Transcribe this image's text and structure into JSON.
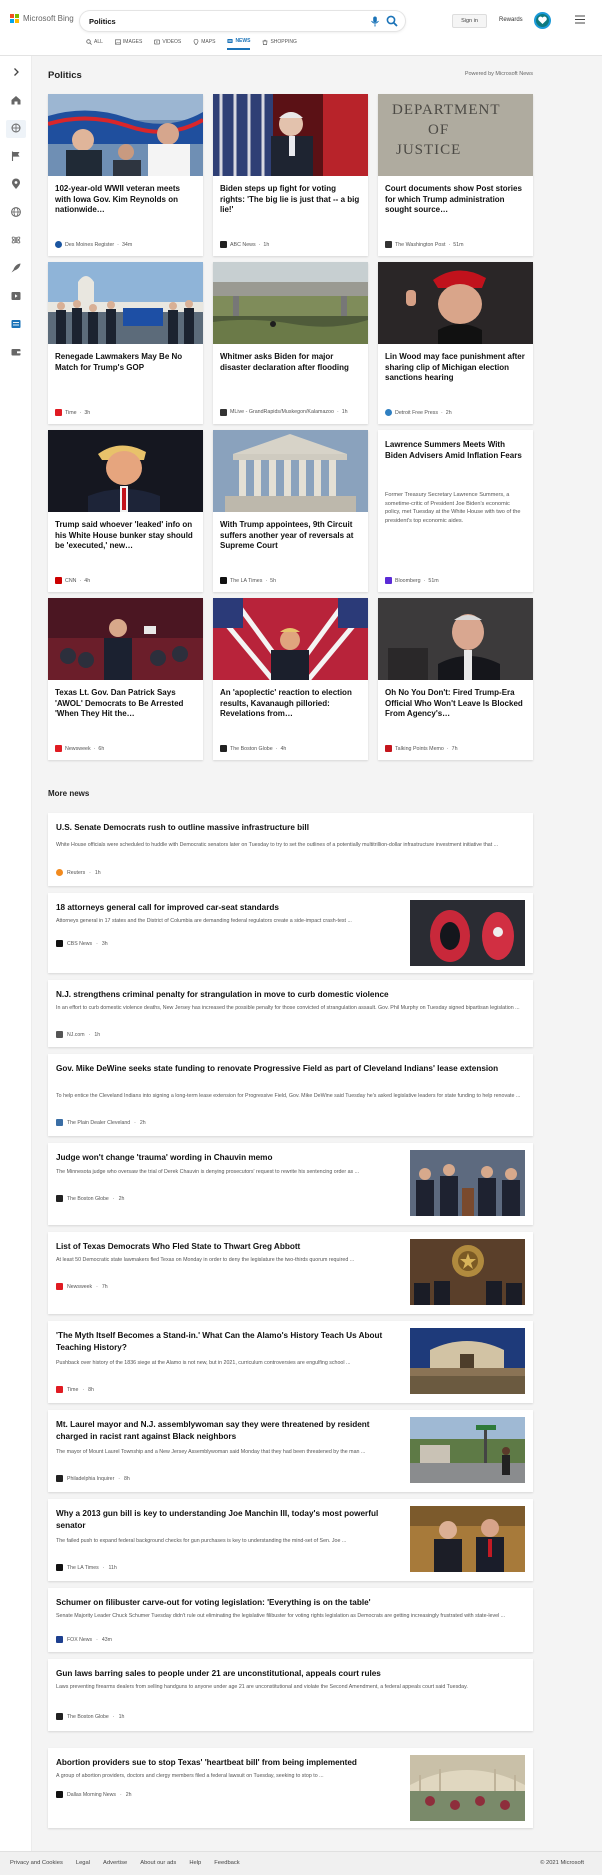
{
  "header": {
    "brand": "Microsoft Bing",
    "search_value": "Politics",
    "signin_label": "Sign in",
    "rewards_label": "Rewards"
  },
  "tabs": [
    {
      "label": "ALL",
      "icon": "search-icon"
    },
    {
      "label": "IMAGES",
      "icon": "image-icon"
    },
    {
      "label": "VIDEOS",
      "icon": "video-icon"
    },
    {
      "label": "MAPS",
      "icon": "map-pin-icon"
    },
    {
      "label": "NEWS",
      "icon": "news-icon"
    },
    {
      "label": "SHOPPING",
      "icon": "shopping-bag-icon"
    }
  ],
  "sidebar": [
    "collapse-icon",
    "home-icon",
    "sports-icon",
    "flag-icon",
    "location-icon",
    "globe-icon",
    "science-icon",
    "rocket-icon",
    "entertainment-icon",
    "news-icon",
    "wallet-icon"
  ],
  "section": {
    "title": "Politics",
    "powered_by": "Powered by Microsoft News"
  },
  "cards": [
    {
      "title": "102-year-old WWII veteran meets with Iowa Gov. Kim Reynolds on nationwide…",
      "source": "Des Moines Register",
      "time": "34m",
      "color": "#1b55a0"
    },
    {
      "title": "Biden steps up fight for voting rights: 'The big lie is just that -- a big lie!'",
      "source": "ABC News",
      "time": "1h",
      "color": "#222222"
    },
    {
      "title": "Court documents show Post stories for which Trump administration sought source…",
      "source": "The Washington Post",
      "time": "51m",
      "color": "#333333"
    },
    {
      "title": "Renegade Lawmakers May Be No Match for Trump's GOP",
      "source": "Time",
      "time": "3h",
      "color": "#e01b22"
    },
    {
      "title": "Whitmer asks Biden for major disaster declaration after flooding",
      "source": "MLive - GrandRapids/Muskegon/Kalamazoo",
      "time": "1h",
      "color": "#333333"
    },
    {
      "title": "Lin Wood may face punishment after sharing clip of Michigan election sanctions hearing",
      "source": "Detroit Free Press",
      "time": "2h",
      "color": "#2f7fc1"
    },
    {
      "title": "Trump said whoever 'leaked' info on his White House bunker stay should be 'executed,' new…",
      "source": "CNN",
      "time": "4h",
      "color": "#cc0000"
    },
    {
      "title": "With Trump appointees, 9th Circuit suffers another year of reversals at Supreme Court",
      "source": "The LA Times",
      "time": "5h",
      "color": "#111111"
    },
    {
      "title": "Lawrence Summers Meets With Biden Advisers Amid Inflation Fears",
      "snippet": "Former Treasury Secretary Lawrence Summers, a sometime-critic of President Joe Biden's economic policy, met Tuesday at the White House with two of the president's top economic aides.",
      "source": "Bloomberg",
      "time": "51m",
      "color": "#5b2bd6"
    },
    {
      "title": "Texas Lt. Gov. Dan Patrick Says 'AWOL' Democrats to Be Arrested 'When They Hit the…",
      "source": "Newsweek",
      "time": "6h",
      "color": "#e01b22"
    },
    {
      "title": "An 'apoplectic' reaction to election results, Kavanaugh pilloried: Revelations from…",
      "source": "The Boston Globe",
      "time": "4h",
      "color": "#222222"
    },
    {
      "title": "Oh No You Don't: Fired Trump-Era Official Who Won't Leave Is Blocked From Agency's…",
      "source": "Talking Points Memo",
      "time": "7h",
      "color": "#c4151c"
    }
  ],
  "more_news": {
    "title": "More news",
    "items": [
      {
        "title": "U.S. Senate Democrats rush to outline massive infrastructure bill",
        "snippet": "White House officials were scheduled to huddle with Democratic senators later on Tuesday to try to set the outlines of a potentially multitrillion-dollar infrastructure investment initiative that ...",
        "source": "Reuters",
        "time": "1h",
        "color": "#f28a1e"
      },
      {
        "title": "18 attorneys general call for improved car-seat standards",
        "snippet": "Attorneys general in 17 states and the District of Columbia are demanding federal regulators create a side-impact crash-test ...",
        "source": "CBS News",
        "time": "3h",
        "color": "#111111"
      },
      {
        "title": "N.J. strengthens criminal penalty for strangulation in move to curb domestic violence",
        "snippet": "In an effort to curb domestic violence deaths, New Jersey has increased the possible penalty for those convicted of strangulation assault. Gov. Phil Murphy on Tuesday signed bipartisan legislation ...",
        "source": "NJ.com",
        "time": "1h",
        "color": "#555555"
      },
      {
        "title": "Gov. Mike DeWine seeks state funding to renovate Progressive Field as part of Cleveland Indians' lease extension",
        "snippet": "To help entice the Cleveland Indians into signing a long-term lease extension for Progressive Field, Gov. Mike DeWine said Tuesday he's asked legislative leaders for state funding to help renovate ...",
        "source": "The Plain Dealer Cleveland",
        "time": "2h",
        "color": "#3a6ea5"
      },
      {
        "title": "Judge won't change 'trauma' wording in Chauvin memo",
        "snippet": "The Minnesota judge who oversaw the trial of Derek Chauvin is denying prosecutors' request to rewrite his sentencing order as ...",
        "source": "The Boston Globe",
        "time": "2h",
        "color": "#222222"
      },
      {
        "title": "List of Texas Democrats Who Fled State to Thwart Greg Abbott",
        "snippet": "At least 50 Democratic state lawmakers fled Texas on Monday in order to deny the legislature the two-thirds quorum required ...",
        "source": "Newsweek",
        "time": "7h",
        "color": "#e01b22"
      },
      {
        "title": "'The Myth Itself Becomes a Stand-in.' What Can the Alamo's History Teach Us About Teaching History?",
        "snippet": "Pushback over history of the 1836 siege at the Alamo is not new, but in 2021, curriculum controversies are engulfing school ...",
        "source": "Time",
        "time": "8h",
        "color": "#e01b22"
      },
      {
        "title": "Mt. Laurel mayor and N.J. assemblywoman say they were threatened by resident charged in racist rant against Black neighbors",
        "snippet": "The mayor of Mount Laurel Township and a New Jersey Assemblywoman said Monday that they had been threatened by the man ...",
        "source": "Philadelphia Inquirer",
        "time": "8h",
        "color": "#222222"
      },
      {
        "title": "Why a 2013 gun bill is key to understanding Joe Manchin III, today's most powerful senator",
        "snippet": "The failed push to expand federal background checks for gun purchases is key to understanding the mind-set of Sen. Joe ...",
        "source": "The LA Times",
        "time": "11h",
        "color": "#111111"
      },
      {
        "title": "Schumer on filibuster carve-out for voting legislation: 'Everything is on the table'",
        "snippet": "Senate Majority Leader Chuck Schumer Tuesday didn't rule out eliminating the legislative filibuster for voting rights legislation as Democrats are getting increasingly frustrated with state-level ...",
        "source": "FOX News",
        "time": "43m",
        "color": "#1d3f8f"
      },
      {
        "title": "Gun laws barring sales to people under 21 are unconstitutional, appeals court rules",
        "snippet": "Laws preventing firearms dealers from selling handguns to anyone under age 21 are unconstitutional and violate the Second Amendment, a federal appeals court said Tuesday.",
        "source": "The Boston Globe",
        "time": "1h",
        "color": "#222222"
      },
      {
        "title": "Abortion providers sue to stop Texas' 'heartbeat bill' from being implemented",
        "snippet": "A group of abortion providers, doctors and clergy members filed a federal lawsuit on Tuesday, seeking to stop to ...",
        "source": "Dallas Morning News",
        "time": "2h",
        "color": "#111111"
      }
    ]
  },
  "footer": {
    "links": [
      "Privacy and Cookies",
      "Legal",
      "Advertise",
      "About our ads",
      "Help",
      "Feedback"
    ],
    "copyright": "© 2021 Microsoft"
  }
}
